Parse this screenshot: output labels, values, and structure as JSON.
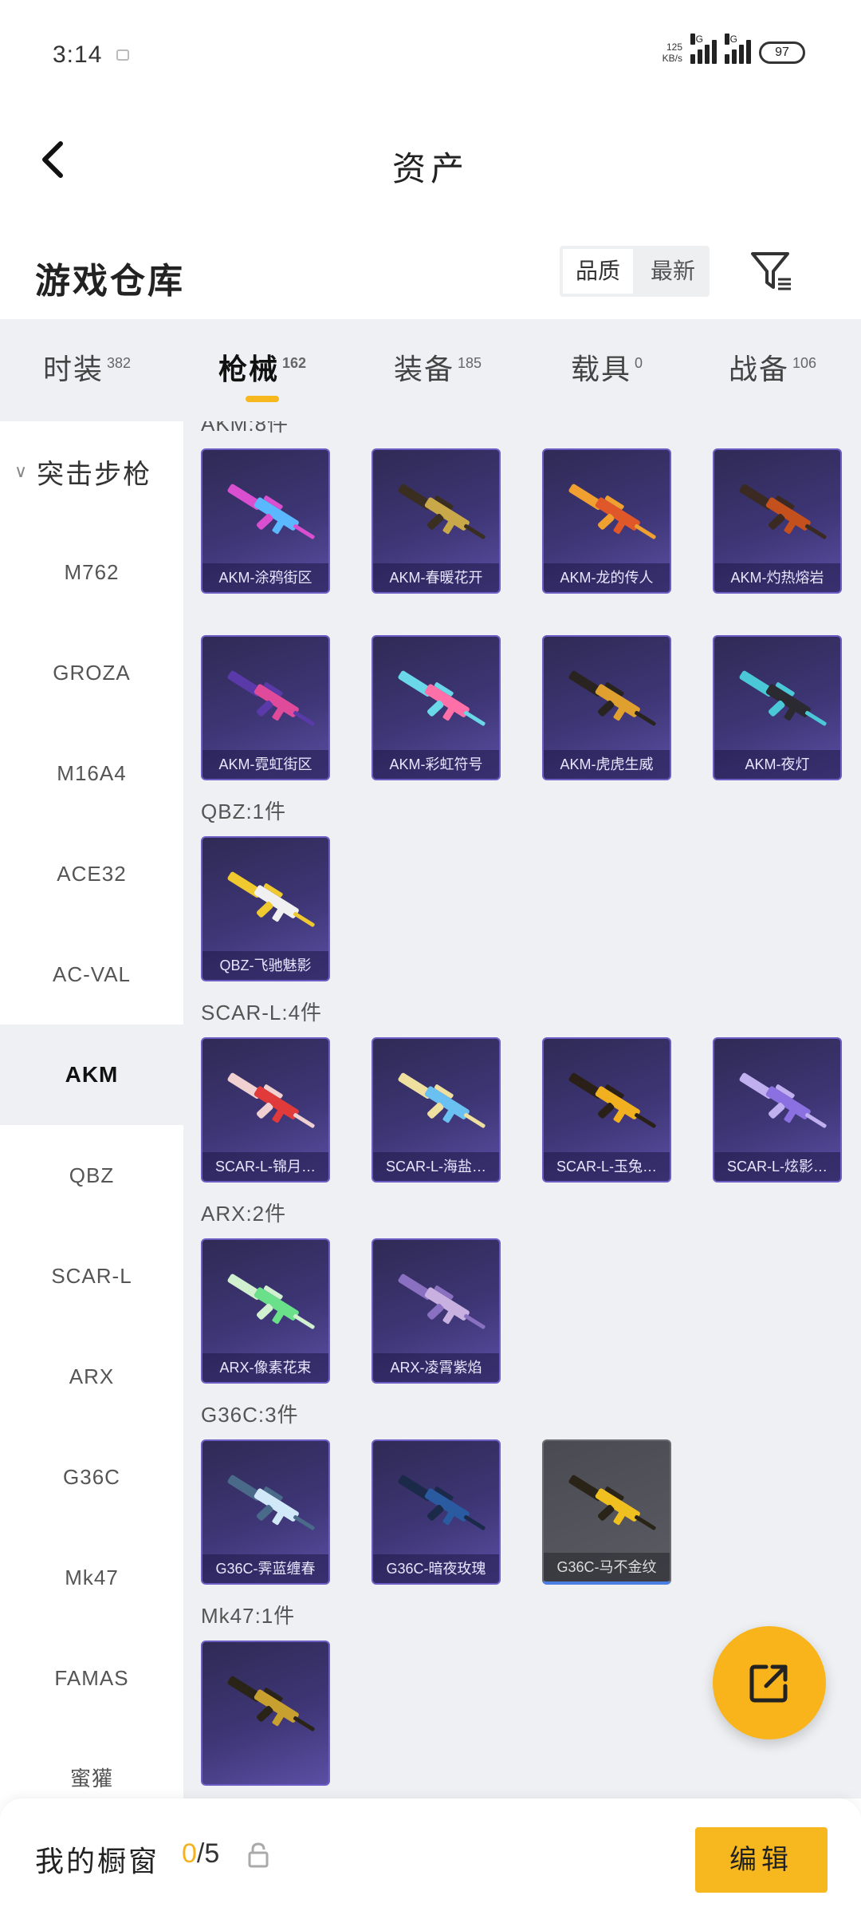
{
  "status_bar": {
    "time": "3:14",
    "net_speed": "125",
    "net_unit": "KB/s",
    "sim1": "5G",
    "sim2": "5G",
    "battery": "97"
  },
  "header": {
    "title": "资产"
  },
  "section": {
    "title": "游戏仓库",
    "sort_options": [
      "品质",
      "最新"
    ],
    "active_sort": "品质"
  },
  "tabs": [
    {
      "label": "时装",
      "count": "382"
    },
    {
      "label": "枪械",
      "count": "162"
    },
    {
      "label": "装备",
      "count": "185"
    },
    {
      "label": "载具",
      "count": "0"
    },
    {
      "label": "战备",
      "count": "106"
    }
  ],
  "sidebar": {
    "group": "突击步枪",
    "items": [
      "M762",
      "GROZA",
      "M16A4",
      "ACE32",
      "AC-VAL",
      "AKM",
      "QBZ",
      "SCAR-L",
      "ARX",
      "G36C",
      "Mk47",
      "FAMAS",
      "蜜獾"
    ],
    "active": "AKM"
  },
  "groups": [
    {
      "label": "AKM:8件",
      "items": [
        "AKM-涂鸦街区",
        "AKM-春暖花开",
        "AKM-龙的传人",
        "AKM-灼热熔岩",
        "AKM-霓虹街区",
        "AKM-彩虹符号",
        "AKM-虎虎生威",
        "AKM-夜灯"
      ]
    },
    {
      "label": "QBZ:1件",
      "items": [
        "QBZ-飞驰魅影"
      ]
    },
    {
      "label": "SCAR-L:4件",
      "items": [
        "SCAR-L-锦月…",
        "SCAR-L-海盐…",
        "SCAR-L-玉兔…",
        "SCAR-L-炫影…"
      ]
    },
    {
      "label": "ARX:2件",
      "items": [
        "ARX-像素花束",
        "ARX-凌霄紫焰"
      ]
    },
    {
      "label": "G36C:3件",
      "items": [
        "G36C-霁蓝缠春",
        "G36C-暗夜玫瑰",
        "G36C-马不金纹"
      ]
    },
    {
      "label": "Mk47:1件",
      "items": [
        ""
      ]
    }
  ],
  "bottom": {
    "label": "我的橱窗",
    "count_current": "0",
    "count_total": "/5",
    "edit_label": "编辑"
  },
  "colors": {
    "accent": "#f6b81e",
    "card_bg": "#3e3676",
    "card_border": "#6a5ec4",
    "panel_bg": "#eef0f3"
  }
}
